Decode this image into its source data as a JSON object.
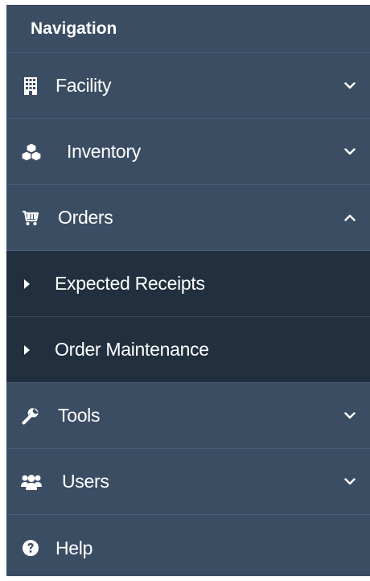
{
  "nav": {
    "title": "Navigation",
    "items": [
      {
        "label": "Facility",
        "icon": "building-icon",
        "expanded": false
      },
      {
        "label": "Inventory",
        "icon": "cubes-icon",
        "expanded": false
      },
      {
        "label": "Orders",
        "icon": "cart-icon",
        "expanded": true,
        "children": [
          {
            "label": "Expected Receipts"
          },
          {
            "label": "Order Maintenance"
          }
        ]
      },
      {
        "label": "Tools",
        "icon": "wrench-icon",
        "expanded": false
      },
      {
        "label": "Users",
        "icon": "users-icon",
        "expanded": false
      },
      {
        "label": "Help",
        "icon": "question-circle-icon"
      }
    ]
  },
  "colors": {
    "panel": "#3b4d63",
    "submenu": "#212f3e",
    "divider": "#4a5d75",
    "text": "#ffffff"
  }
}
